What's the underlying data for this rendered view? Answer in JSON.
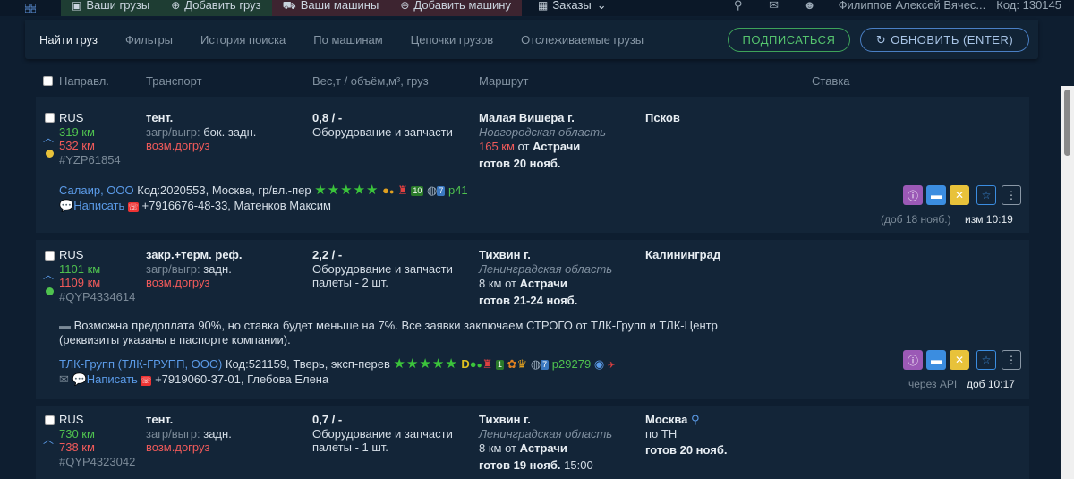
{
  "topnav": {
    "items": [
      {
        "label": "Ваши грузы",
        "icon": "box-icon"
      },
      {
        "label": "Добавить груз",
        "icon": "plus-circle-icon"
      },
      {
        "label": "Ваши машины",
        "icon": "truck-icon"
      },
      {
        "label": "Добавить машину",
        "icon": "plus-circle-icon"
      },
      {
        "label": "Заказы",
        "icon": "calendar-icon"
      }
    ],
    "user": "Филиппов Алексей Вячес...",
    "code": "Код: 130145"
  },
  "subtabs": {
    "items": [
      "Найти груз",
      "Фильтры",
      "История поиска",
      "По машинам",
      "Цепочки грузов",
      "Отслеживаемые грузы"
    ],
    "subscribe": "ПОДПИСАТЬСЯ",
    "refresh": "ОБНОВИТЬ (ENTER)"
  },
  "columns": {
    "direction": "Направл.",
    "transport": "Транспорт",
    "weight": "Вес,т / объём,м³, груз",
    "route": "Маршрут",
    "rate": "Ставка"
  },
  "cards": [
    {
      "country": "RUS",
      "km1": "319 км",
      "km2": "532 км",
      "id": "#YZP61854",
      "dot_color": "#e8c23a",
      "transport": "тент.",
      "load_label": "загр/выгр:",
      "load_value": "бок. задн.",
      "extra": "возм.догруз",
      "weight": "0,8 / -",
      "cargo": "Оборудование и запчасти",
      "cargo2": "",
      "from_city": "Малая Вишера г.",
      "from_region": "Новгородская область",
      "dist_km": "165 км",
      "dist_from": "от",
      "dist_city": "Астрачи",
      "ready": "готов 20 нояб.",
      "to_city": "Псков",
      "company": "Салаир, ООО",
      "company_info": "Код:2020553, Москва, гр/вл.-пер",
      "rating": "р41",
      "badge_a": "10",
      "badge_b": "7",
      "write": "Написать",
      "phone": "+7916676-48-33, Матенков Максим",
      "meta_left": "(доб 18 нояб.)",
      "meta_right": "изм 10:19"
    },
    {
      "country": "RUS",
      "km1": "1101 км",
      "km2": "1109 км",
      "id": "#QYP4334614",
      "dot_color": "#4fc24f",
      "transport": "закр.+терм. реф.",
      "load_label": "загр/выгр:",
      "load_value": "задн.",
      "extra": "возм.догруз",
      "weight": "2,2 / -",
      "cargo": "Оборудование и запчасти",
      "cargo2": "палеты - 2 шт.",
      "from_city": "Тихвин г.",
      "from_region": "Ленинградская область",
      "dist_km": "8 км",
      "dist_from": "от",
      "dist_city": "Астрачи",
      "ready": "готов 21-24 нояб.",
      "to_city": "Калининград",
      "note1": "Возможна предоплата 90%, но ставка будет меньше на 7%. Все заявки заключаем СТРОГО от ТЛК-Групп и ТЛК-Центр",
      "note2": "(реквизиты указаны в паспорте компании).",
      "company": "ТЛК-Групп (ТЛК-ГРУПП, ООО)",
      "company_info": "Код:521159, Тверь, эксп-перев",
      "rating": "р29279",
      "badge_a": "1",
      "badge_b": "7",
      "write": "Написать",
      "phone": "+7919060-37-01, Глебова Елена",
      "meta_left": "через API",
      "meta_right": "доб 10:17"
    },
    {
      "country": "RUS",
      "km1": "730 км",
      "km2": "738 км",
      "id": "#QYP4323042",
      "transport": "тент.",
      "load_label": "загр/выгр:",
      "load_value": "задн.",
      "extra": "возм.догруз",
      "weight": "0,7 / -",
      "cargo": "Оборудование и запчасти",
      "cargo2": "палеты - 1 шт.",
      "from_city": "Тихвин г.",
      "from_region": "Ленинградская область",
      "dist_km": "8 км",
      "dist_from": "от",
      "dist_city": "Астрачи",
      "ready": "готов 19 нояб.",
      "ready_time": "15:00",
      "to_city": "Москва",
      "to_sub": "по ТН",
      "to_ready": "готов 20 нояб."
    }
  ]
}
